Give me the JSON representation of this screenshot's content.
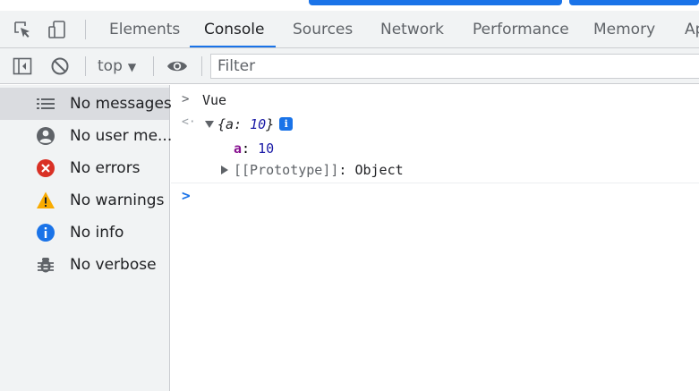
{
  "tabs": [
    {
      "label": "Elements",
      "active": false
    },
    {
      "label": "Console",
      "active": true
    },
    {
      "label": "Sources",
      "active": false
    },
    {
      "label": "Network",
      "active": false
    },
    {
      "label": "Performance",
      "active": false
    },
    {
      "label": "Memory",
      "active": false
    },
    {
      "label": "Ap",
      "active": false
    }
  ],
  "toolbar": {
    "context": "top",
    "filter_placeholder": "Filter"
  },
  "sidebar": {
    "items": [
      {
        "label": "No messages",
        "icon": "list-icon",
        "selected": true
      },
      {
        "label": "No user me...",
        "icon": "user-icon",
        "selected": false
      },
      {
        "label": "No errors",
        "icon": "error-icon",
        "selected": false
      },
      {
        "label": "No warnings",
        "icon": "warning-icon",
        "selected": false
      },
      {
        "label": "No info",
        "icon": "info-icon",
        "selected": false
      },
      {
        "label": "No verbose",
        "icon": "bug-icon",
        "selected": false
      }
    ]
  },
  "console": {
    "input_expression": "Vue",
    "result_open": "{",
    "result_key": "a",
    "result_sep": ": ",
    "result_value": "10",
    "result_close": "}",
    "prop_key": "a",
    "prop_sep": ": ",
    "prop_value": "10",
    "proto_label": "[[Prototype]]",
    "proto_sep": ": ",
    "proto_value": "Object",
    "info_badge": "i"
  },
  "colors": {
    "accent": "#1a73e8",
    "error": "#d93025",
    "warning": "#f9ab00",
    "prop_key": "#881391",
    "number": "#1a1aa6"
  }
}
